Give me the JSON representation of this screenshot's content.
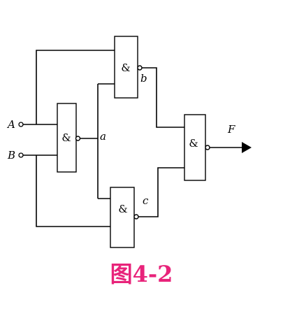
{
  "diagram": {
    "inputs": [
      "A",
      "B"
    ],
    "output": "F",
    "nodes": [
      "a",
      "b",
      "c"
    ],
    "gate_symbol": "&"
  },
  "caption": {
    "text": "图4-2",
    "color": "#e8237a"
  }
}
